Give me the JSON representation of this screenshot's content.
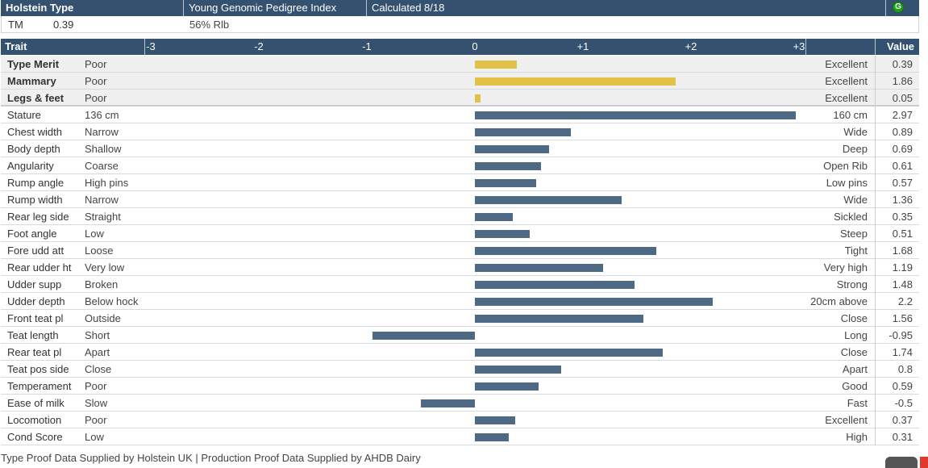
{
  "header": {
    "breed": "Holstein Type",
    "index_name": "Young Genomic Pedigree Index",
    "calculated": "Calculated 8/18",
    "badge": "G"
  },
  "summary": {
    "tm_label": "TM",
    "tm_value": "0.39",
    "reliability": "56% Rlb"
  },
  "table_header": {
    "trait": "Trait",
    "value": "Value",
    "ticks": [
      "-3",
      "-2",
      "-1",
      "0",
      "+1",
      "+2",
      "+3"
    ]
  },
  "scale": {
    "min": -3,
    "max": 3
  },
  "colors": {
    "header_bg": "#34516f",
    "composite_bar": "#e2c244",
    "trait_bar": "#4e6984"
  },
  "traits": [
    {
      "name": "Type Merit",
      "low": "Poor",
      "high": "Excellent",
      "value": "0.39",
      "composite": true
    },
    {
      "name": "Mammary",
      "low": "Poor",
      "high": "Excellent",
      "value": "1.86",
      "composite": true
    },
    {
      "name": "Legs & feet",
      "low": "Poor",
      "high": "Excellent",
      "value": "0.05",
      "composite": true
    },
    {
      "name": "Stature",
      "low": "136 cm",
      "high": "160 cm",
      "value": "2.97",
      "composite": false
    },
    {
      "name": "Chest width",
      "low": "Narrow",
      "high": "Wide",
      "value": "0.89",
      "composite": false
    },
    {
      "name": "Body depth",
      "low": "Shallow",
      "high": "Deep",
      "value": "0.69",
      "composite": false
    },
    {
      "name": "Angularity",
      "low": "Coarse",
      "high": "Open Rib",
      "value": "0.61",
      "composite": false
    },
    {
      "name": "Rump angle",
      "low": "High pins",
      "high": "Low pins",
      "value": "0.57",
      "composite": false
    },
    {
      "name": "Rump width",
      "low": "Narrow",
      "high": "Wide",
      "value": "1.36",
      "composite": false
    },
    {
      "name": "Rear leg side",
      "low": "Straight",
      "high": "Sickled",
      "value": "0.35",
      "composite": false
    },
    {
      "name": "Foot angle",
      "low": "Low",
      "high": "Steep",
      "value": "0.51",
      "composite": false
    },
    {
      "name": "Fore udd att",
      "low": "Loose",
      "high": "Tight",
      "value": "1.68",
      "composite": false
    },
    {
      "name": "Rear udder ht",
      "low": "Very low",
      "high": "Very high",
      "value": "1.19",
      "composite": false
    },
    {
      "name": "Udder supp",
      "low": "Broken",
      "high": "Strong",
      "value": "1.48",
      "composite": false
    },
    {
      "name": "Udder depth",
      "low": "Below hock",
      "high": "20cm above",
      "value": "2.2",
      "composite": false
    },
    {
      "name": "Front teat pl",
      "low": "Outside",
      "high": "Close",
      "value": "1.56",
      "composite": false
    },
    {
      "name": "Teat length",
      "low": "Short",
      "high": "Long",
      "value": "-0.95",
      "composite": false
    },
    {
      "name": "Rear teat pl",
      "low": "Apart",
      "high": "Close",
      "value": "1.74",
      "composite": false
    },
    {
      "name": "Teat pos side",
      "low": "Close",
      "high": "Apart",
      "value": "0.8",
      "composite": false
    },
    {
      "name": "Temperament",
      "low": "Poor",
      "high": "Good",
      "value": "0.59",
      "composite": false
    },
    {
      "name": "Ease of milk",
      "low": "Slow",
      "high": "Fast",
      "value": "-0.5",
      "composite": false
    },
    {
      "name": "Locomotion",
      "low": "Poor",
      "high": "Excellent",
      "value": "0.37",
      "composite": false
    },
    {
      "name": "Cond Score",
      "low": "Low",
      "high": "High",
      "value": "0.31",
      "composite": false
    }
  ],
  "footer": "Type Proof Data Supplied by Holstein UK | Production Proof Data Supplied by AHDB Dairy"
}
